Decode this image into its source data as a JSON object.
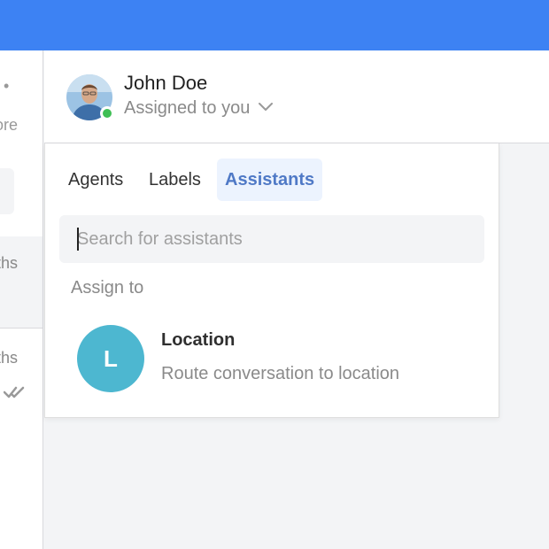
{
  "header": {
    "contact_name": "John Doe",
    "assignee_status": "Assigned to you",
    "presence_color": "#3fbf54"
  },
  "left_list": {
    "fragment_dot": "•",
    "fragment_ore": "ore",
    "fragment_ths_1": "ths",
    "fragment_ths_2": "ths"
  },
  "popover": {
    "tabs": [
      {
        "label": "Agents",
        "active": false
      },
      {
        "label": "Labels",
        "active": false
      },
      {
        "label": "Assistants",
        "active": true
      }
    ],
    "search": {
      "placeholder": "Search for assistants",
      "value": ""
    },
    "section_label": "Assign to",
    "assistants": [
      {
        "initial": "L",
        "name": "Location",
        "description": "Route conversation to location",
        "color": "#4db7d0"
      }
    ]
  },
  "colors": {
    "topbar": "#3d82f3",
    "active_tab_bg": "#ecf3fe",
    "active_tab_text": "#4f79c6"
  },
  "icons": [
    "avatar-photo",
    "chevron-down-icon",
    "double-check-icon"
  ]
}
